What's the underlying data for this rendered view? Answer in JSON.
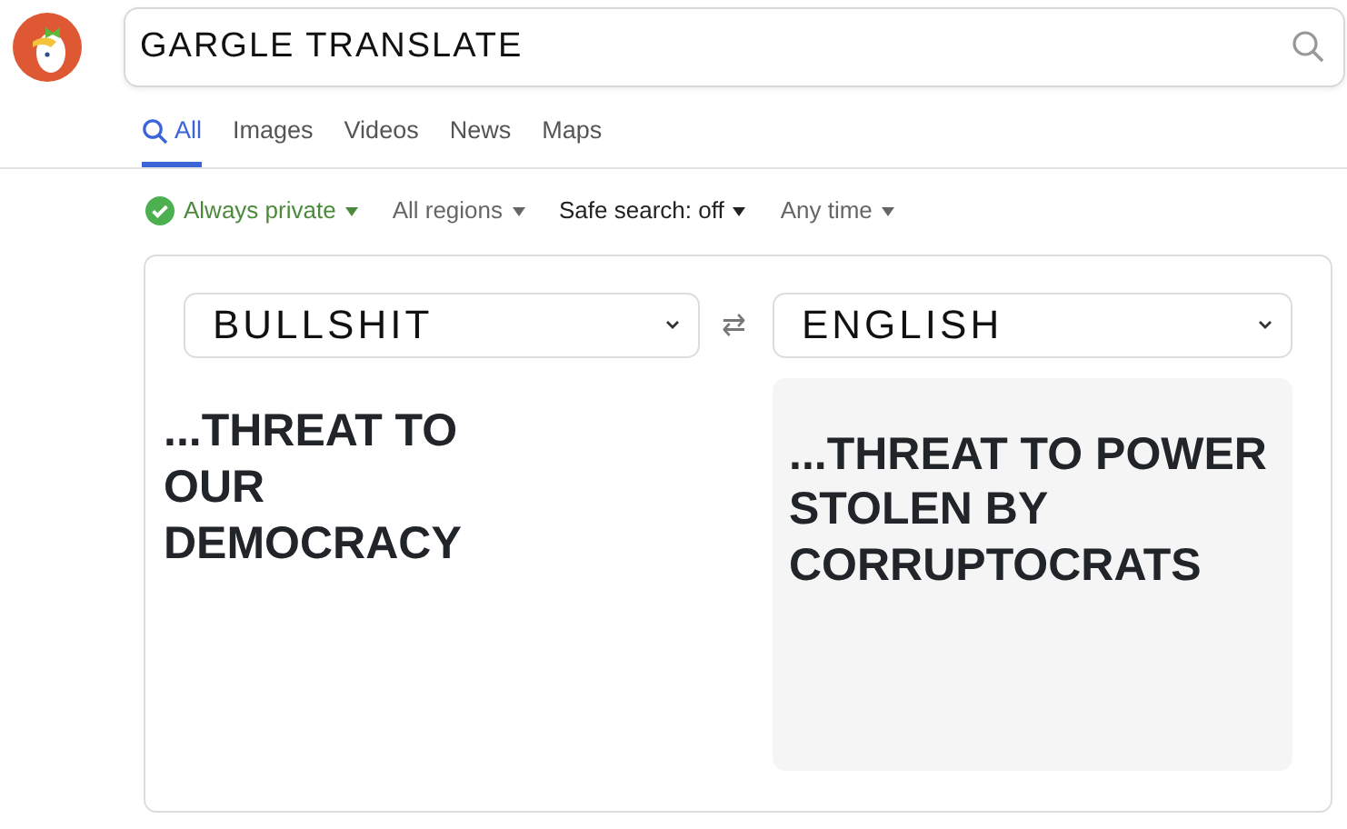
{
  "search": {
    "value": "GARGLE TRANSLATE"
  },
  "tabs": [
    {
      "label": "All",
      "selected": true
    },
    {
      "label": "Images",
      "selected": false
    },
    {
      "label": "Videos",
      "selected": false
    },
    {
      "label": "News",
      "selected": false
    },
    {
      "label": "Maps",
      "selected": false
    }
  ],
  "filters": [
    {
      "label": "Always private",
      "kind": "privacy",
      "active": false
    },
    {
      "label": "All regions",
      "kind": "dropdown",
      "active": false
    },
    {
      "label": "Safe search: off",
      "kind": "dropdown",
      "active": true
    },
    {
      "label": "Any time",
      "kind": "dropdown",
      "active": false
    }
  ],
  "translator": {
    "source_language": "BULLSHIT",
    "swap": "⇄",
    "target_language": "ENGLISH",
    "source_text": "...THREAT TO OUR DEMOCRACY",
    "translation": "...THREAT TO POWER STOLEN BY CORRUPTOCRATS"
  }
}
